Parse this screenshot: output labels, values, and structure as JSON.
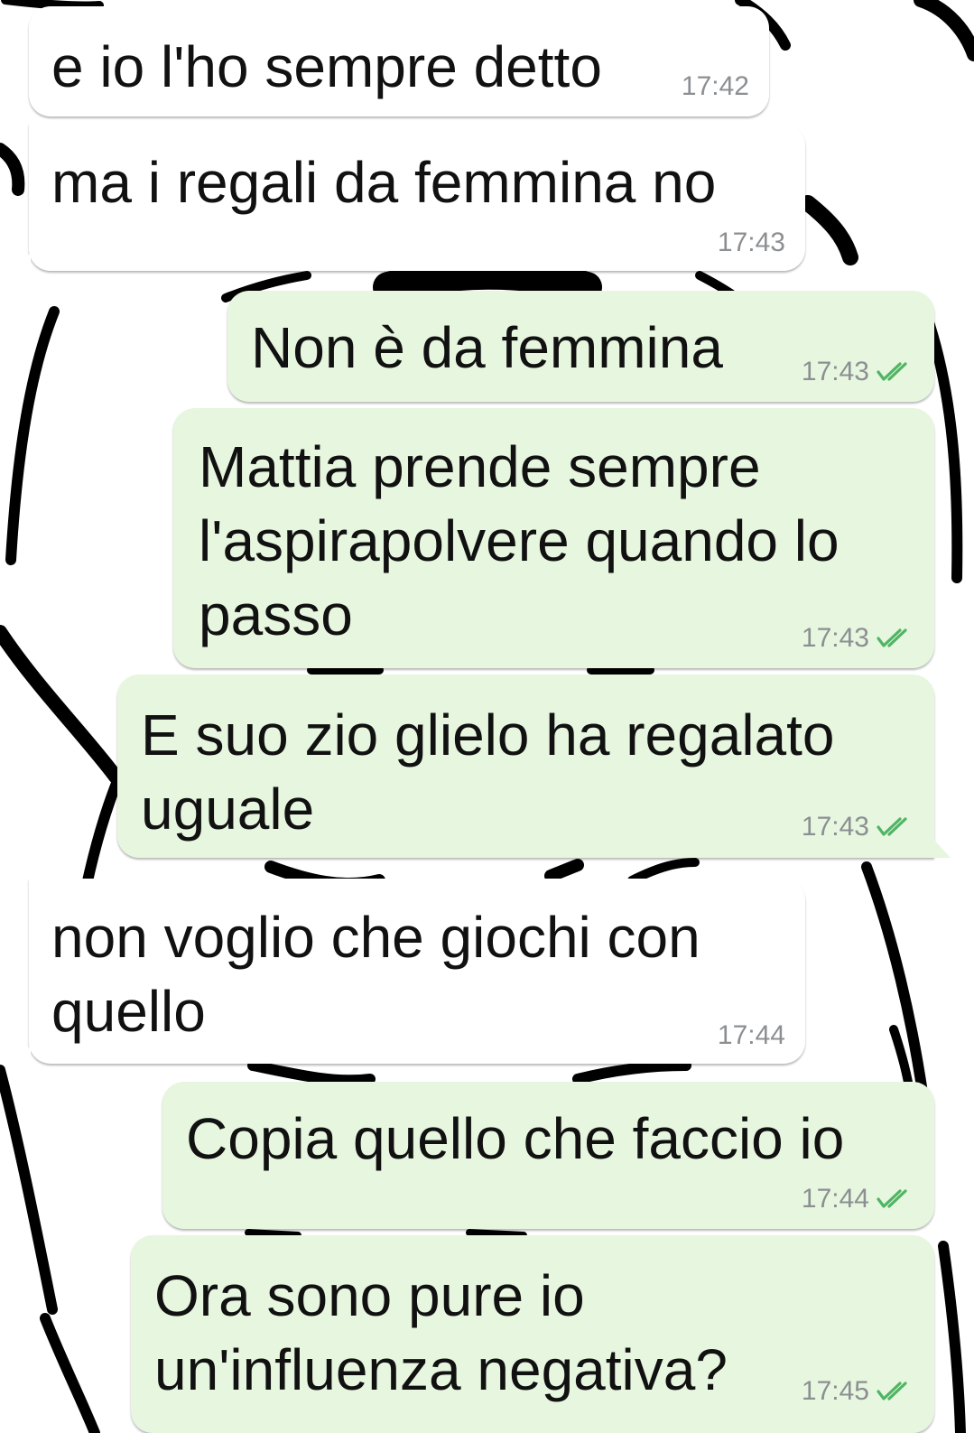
{
  "colors": {
    "incoming_bubble": "#ffffff",
    "outgoing_bubble": "#e7f6df",
    "timestamp": "#8c8f92",
    "read_ticks": "#4fb564"
  },
  "messages": [
    {
      "direction": "incoming",
      "text": "e io l'ho sempre detto",
      "time": "17:42"
    },
    {
      "direction": "incoming",
      "text": "ma i regali da femmina no",
      "time": "17:43"
    },
    {
      "direction": "outgoing",
      "text": "Non è da femmina",
      "time": "17:43",
      "status_icon": "double-check-icon"
    },
    {
      "direction": "outgoing",
      "text": "Mattia prende sempre\nl'aspirapolvere quando lo\npasso",
      "time": "17:43",
      "status_icon": "double-check-icon"
    },
    {
      "direction": "outgoing",
      "text": "E suo zio glielo ha regalato\nuguale",
      "time": "17:43",
      "status_icon": "double-check-icon"
    },
    {
      "direction": "incoming",
      "text": "non voglio che giochi con\nquello",
      "time": "17:44"
    },
    {
      "direction": "outgoing",
      "text": "Copia quello che faccio io",
      "time": "17:44",
      "status_icon": "double-check-icon"
    },
    {
      "direction": "outgoing",
      "text": "Ora sono pure io\nun'influenza negativa?",
      "time": "17:45",
      "status_icon": "double-check-icon"
    }
  ]
}
